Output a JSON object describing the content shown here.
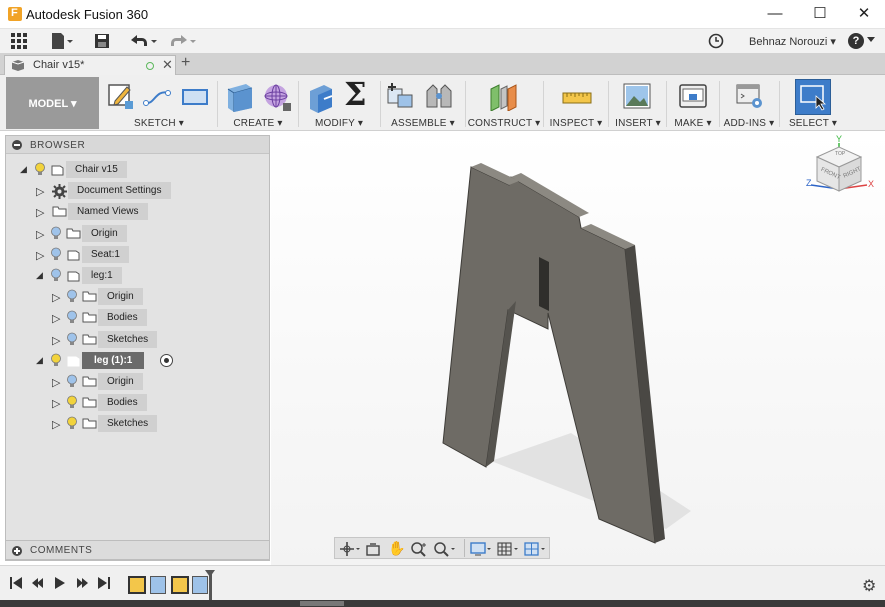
{
  "window": {
    "title": "Autodesk Fusion 360",
    "controls": [
      "—",
      "☐",
      "✕"
    ]
  },
  "quickbar": {
    "user": "Behnaz Norouzi ▾",
    "help": "?"
  },
  "document_tab": {
    "name": "Chair v15*",
    "add": "+"
  },
  "toolbar": {
    "workspace": "MODEL ▾",
    "groups": [
      {
        "label": "SKETCH ▾"
      },
      {
        "label": "CREATE ▾"
      },
      {
        "label": "MODIFY ▾"
      },
      {
        "label": "ASSEMBLE ▾"
      },
      {
        "label": "CONSTRUCT ▾"
      },
      {
        "label": "INSPECT ▾"
      },
      {
        "label": "INSERT ▾"
      },
      {
        "label": "MAKE ▾"
      },
      {
        "label": "ADD-INS ▾"
      },
      {
        "label": "SELECT ▾"
      }
    ]
  },
  "browser": {
    "title": "BROWSER",
    "items": [
      {
        "label": "Chair v15"
      },
      {
        "label": "Document Settings"
      },
      {
        "label": "Named Views"
      },
      {
        "label": "Origin"
      },
      {
        "label": "Seat:1"
      },
      {
        "label": "leg:1"
      },
      {
        "label": "Origin"
      },
      {
        "label": "Bodies"
      },
      {
        "label": "Sketches"
      },
      {
        "label": "leg (1):1"
      },
      {
        "label": "Origin"
      },
      {
        "label": "Bodies"
      },
      {
        "label": "Sketches"
      }
    ]
  },
  "comments": {
    "title": "COMMENTS"
  },
  "viewcube": {
    "top": "TOP",
    "front": "FRONT",
    "right": "RIGHT",
    "axis_x": "X",
    "axis_y": "Y",
    "axis_z": "Z"
  },
  "colors": {
    "accent": "#4a7fb5",
    "part": "#6e6b65",
    "bulb": "#f2d33c",
    "bulb_off": "#9fc3ea"
  }
}
